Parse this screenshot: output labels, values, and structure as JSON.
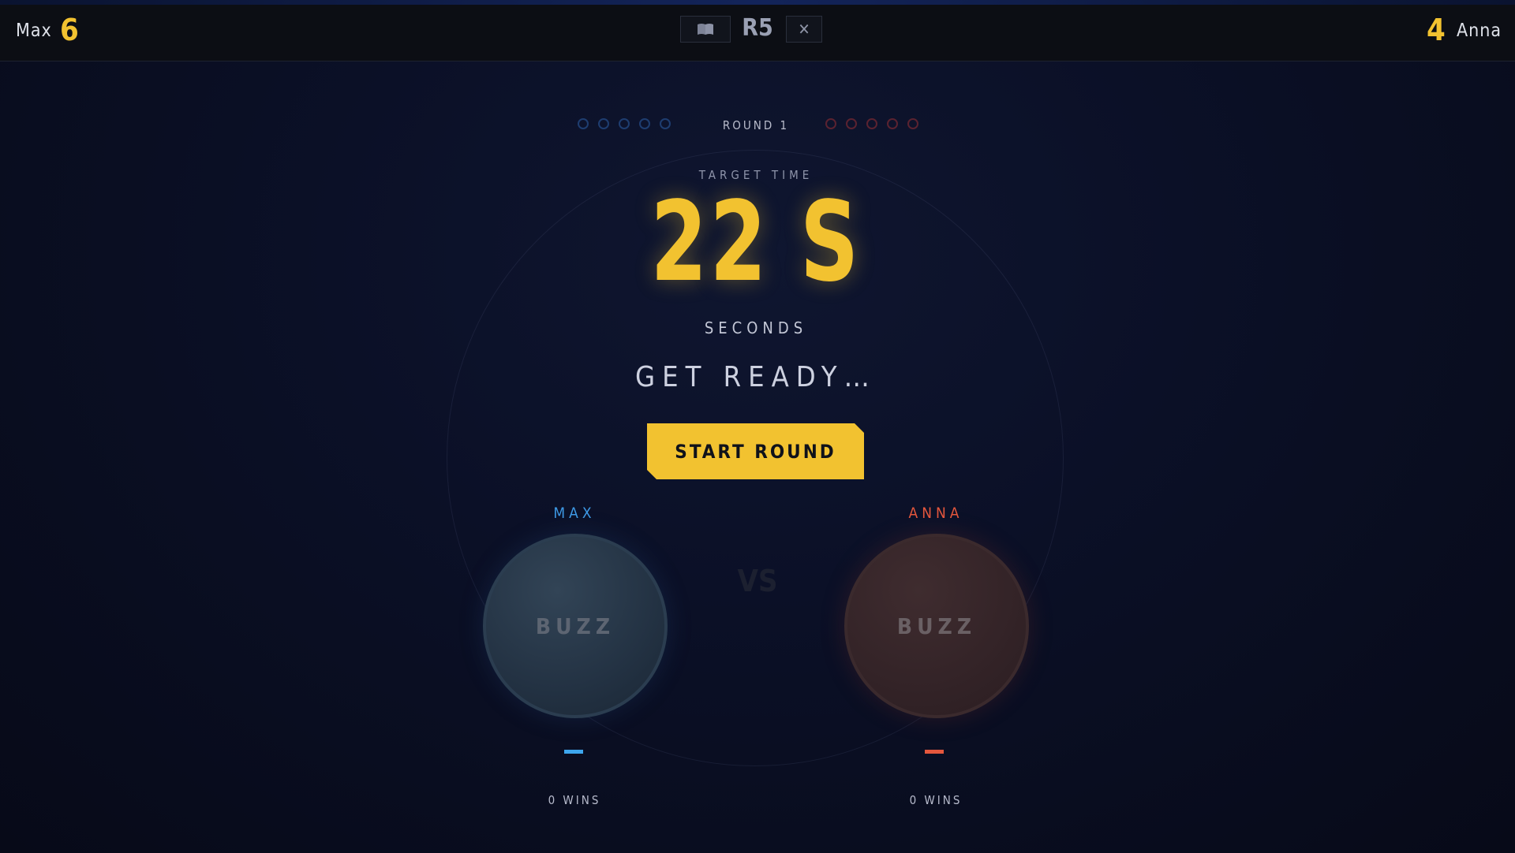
{
  "topbar": {
    "left_player": {
      "name": "Max",
      "score": "6"
    },
    "right_player": {
      "name": "Anna",
      "score": "4"
    },
    "round_label": "R5",
    "book_icon": "book-icon",
    "close_icon": "close-icon",
    "close_glyph": "✕"
  },
  "progress": {
    "round_indicator": "ROUND 1",
    "left_dots": 5,
    "right_dots": 5
  },
  "target": {
    "label": "TARGET TIME",
    "value": "22 S",
    "unit": "SECONDS"
  },
  "status": "GET READY…",
  "start_button": "START ROUND",
  "vs": "VS",
  "players": [
    {
      "name": "MAX",
      "buzz_label": "BUZZ",
      "wins": "0 WINS",
      "color": "#3e9ae6"
    },
    {
      "name": "ANNA",
      "buzz_label": "BUZZ",
      "wins": "0 WINS",
      "color": "#e5573d"
    }
  ],
  "colors": {
    "accent": "#f2c230",
    "background": "#0b1027"
  }
}
